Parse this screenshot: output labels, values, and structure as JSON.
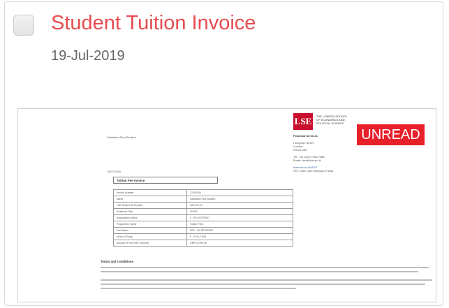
{
  "card": {
    "title": "Student Tuition Invoice",
    "date": "19-Jul-2019",
    "status_badge": "UNREAD"
  },
  "preview": {
    "to_line": "Salutation First Student",
    "logo_text": "LSE",
    "org_name_lines": [
      "THE LONDON SCHOOL",
      "OF ECONOMICS AND",
      "POLITICAL SCIENCE"
    ],
    "dept": "Financial Services",
    "address_lines": [
      "Houghton Street",
      "London",
      "WC2A 2AE"
    ],
    "contact_lines": [
      "Tel:      +44 (0)20 7955 7086",
      "Email:    fees@lse.ac.uk"
    ],
    "web_lines": [
      "www.lse.ac.uk/FSS",
      "Hrs: 10am–4pm Monday–Friday"
    ],
    "doc_date": "19/07/2019",
    "doc_heading": "Tuition Fee Invoice",
    "rows": [
      {
        "k": "Invoice Number",
        "v": "12345789"
      },
      {
        "k": "Name",
        "v": "Salutation First Student"
      },
      {
        "k": "LSE Student ID Number",
        "v": "20XXXX-01"
      },
      {
        "k": "Academic Year",
        "v": "2019/0"
      },
      {
        "k": "Registration Status",
        "v": "0 - REGISTERED"
      },
      {
        "k": "Programme Name",
        "v": "Tuition Fees"
      },
      {
        "k": "Fee Status",
        "v": "FEE - UK RESIDENT"
      },
      {
        "k": "Mode of Study",
        "v": "F - FULL TIME"
      },
      {
        "k": "Amount of Fee (NET amount)",
        "v": "GBP        £9,999.00"
      }
    ],
    "terms_heading": "Terms and Conditions"
  }
}
